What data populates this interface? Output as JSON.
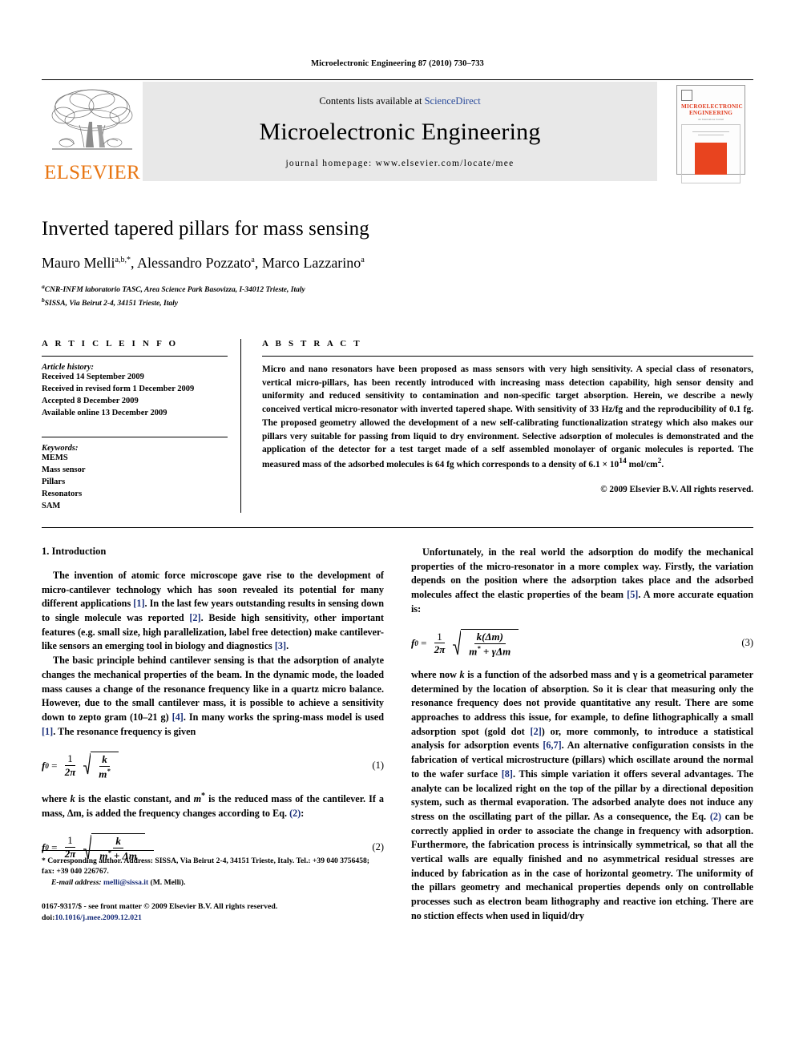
{
  "running_head": "Microelectronic Engineering 87 (2010) 730–733",
  "banner": {
    "contents_prefix": "Contents lists available at ",
    "sciencedirect": "ScienceDirect",
    "journal_name": "Microelectronic Engineering",
    "homepage": "journal homepage: www.elsevier.com/locate/mee",
    "publisher_wordmark": "ELSEVIER",
    "cover_title_line1": "MICROELECTRONIC",
    "cover_title_line2": "ENGINEERING",
    "cover_subtitle": "An Internationa Journal",
    "accent_orange": "#E87511",
    "cover_red": "#E03A1E",
    "link_blue": "#2a4b9b"
  },
  "article": {
    "title": "Inverted tapered pillars for mass sensing",
    "authors": "Mauro Melli a,b,*, Alessandro Pozzato a, Marco Lazzarino a",
    "author_parts": [
      {
        "name": "Mauro Melli",
        "sup": "a,b,*"
      },
      {
        "name": ", Alessandro Pozzato",
        "sup": "a"
      },
      {
        "name": ", Marco Lazzarino",
        "sup": "a"
      }
    ],
    "affiliations": [
      {
        "marker": "a",
        "text": "CNR-INFM laboratorio TASC, Area Science Park Basovizza, I-34012 Trieste, Italy"
      },
      {
        "marker": "b",
        "text": "SISSA, Via Beirut 2-4, 34151 Trieste, Italy"
      }
    ]
  },
  "info": {
    "heading": "A R T I C L E    I N F O",
    "history_label": "Article history:",
    "history": [
      "Received 14 September 2009",
      "Received in revised form 1 December 2009",
      "Accepted 8 December 2009",
      "Available online 13 December 2009"
    ],
    "keywords_label": "Keywords:",
    "keywords": [
      "MEMS",
      "Mass sensor",
      "Pillars",
      "Resonators",
      "SAM"
    ]
  },
  "abstract": {
    "heading": "A B S T R A C T",
    "text": "Micro and nano resonators have been proposed as mass sensors with very high sensitivity. A special class of resonators, vertical micro-pillars, has been recently introduced with increasing mass detection capability, high sensor density and uniformity and reduced sensitivity to contamination and non-specific target absorption. Herein, we describe a newly conceived vertical micro-resonator with inverted tapered shape. With sensitivity of 33 Hz/fg and the reproducibility of 0.1 fg. The proposed geometry allowed the development of a new self-calibrating functionalization strategy which also makes our pillars very suitable for passing from liquid to dry environment. Selective adsorption of molecules is demonstrated and the application of the detector for a test target made of a self assembled monolayer of organic molecules is reported. The measured mass of the adsorbed molecules is 64 fg which corresponds to a density of 6.1 × 10",
    "density_exponent": "14",
    "density_tail": " mol/cm",
    "density_tail_sup": "2",
    "density_end": ".",
    "copyright": "© 2009 Elsevier B.V. All rights reserved."
  },
  "body": {
    "section1_title": "1. Introduction",
    "left_p1_a": "The invention of atomic force microscope gave rise to the development of micro-cantilever technology which has soon revealed its potential for many different applications ",
    "left_p1_c1": "[1]",
    "left_p1_b": ". In the last few years outstanding results in sensing down to single molecule was reported ",
    "left_p1_c2": "[2]",
    "left_p1_c": ". Beside high sensitivity, other important features (e.g. small size, high parallelization, label free detection) make cantilever-like sensors an emerging tool in biology and diagnostics ",
    "left_p1_c3": "[3]",
    "left_p1_d": ".",
    "left_p2_a": "The basic principle behind cantilever sensing is that the adsorption of analyte changes the mechanical properties of the beam. In the dynamic mode, the loaded mass causes a change of the resonance frequency like in a quartz micro balance. However, due to the small cantilever mass, it is possible to achieve a sensitivity down to zepto gram (10–21 g) ",
    "left_p2_c1": "[4]",
    "left_p2_b": ". In many works the spring-mass model is used ",
    "left_p2_c2": "[1]",
    "left_p2_c": ". The resonance frequency is given",
    "eq1_number": "(1)",
    "left_p3_a": "where ",
    "left_p3_k": "k",
    "left_p3_b": " is the elastic constant, and ",
    "left_p3_m": "m",
    "left_p3_c": " is the reduced mass of the cantilever. If a mass, Δm, is added the frequency changes according to Eq. ",
    "left_p3_eqref": "(2)",
    "left_p3_d": ":",
    "eq2_number": "(2)",
    "right_p1_a": "Unfortunately, in the real world the adsorption do modify the mechanical properties of the micro-resonator in a more complex way. Firstly, the variation depends on the position where the adsorption takes place and the adsorbed molecules affect the elastic properties of the beam ",
    "right_p1_c1": "[5]",
    "right_p1_b": ". A more accurate equation is:",
    "eq3_number": "(3)",
    "right_p2_a": "where now ",
    "right_p2_k": "k",
    "right_p2_b": " is a function of the adsorbed mass and γ is a geometrical parameter determined by the location of absorption. So it is clear that measuring only the resonance frequency does not provide quantitative any result. There are some approaches to address this issue, for example, to define lithographically a small adsorption spot (gold dot ",
    "right_p2_c1": "[2]",
    "right_p2_c": ") or, more commonly, to introduce a statistical analysis for adsorption events ",
    "right_p2_c2": "[6,7]",
    "right_p2_d": ". An alternative configuration consists in the fabrication of vertical microstructure (pillars) which oscillate around the normal to the wafer surface ",
    "right_p2_c3": "[8]",
    "right_p2_e": ". This simple variation it offers several advantages. The analyte can be localized right on the top of the pillar by a directional deposition system, such as thermal evaporation. The adsorbed analyte does not induce any stress on the oscillating part of the pillar. As a consequence, the Eq. ",
    "right_p2_eqref": "(2)",
    "right_p2_f": " can be correctly applied in order to associate the change in frequency with adsorption. Furthermore, the fabrication process is intrinsically symmetrical, so that all the vertical walls are equally finished and no asymmetrical residual stresses are induced by fabrication as in the case of horizontal geometry. The uniformity of the pillars geometry and mechanical properties depends only on controllable processes such as electron beam lithography and reactive ion etching. There are no stiction effects when used in liquid/dry"
  },
  "footnote": {
    "star": "*",
    "corresponding": " Corresponding author. Address: SISSA, Via Beirut 2-4, 34151 Trieste, Italy. Tel.: +39 040 3756458; fax: +39 040 226767.",
    "email_label": "E-mail address:",
    "email": "melli@sissa.it",
    "email_author": " (M. Melli).",
    "imprint_line1": "0167-9317/$ - see front matter © 2009 Elsevier B.V. All rights reserved.",
    "doi_label": "doi:",
    "doi": "10.1016/j.mee.2009.12.021"
  }
}
